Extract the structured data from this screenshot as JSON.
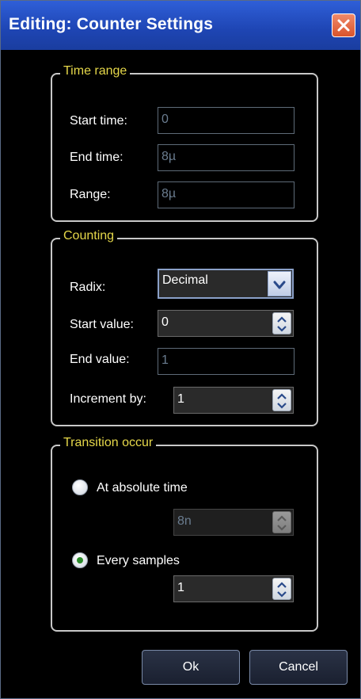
{
  "window": {
    "title": "Editing: Counter Settings"
  },
  "time_range": {
    "legend": "Time range",
    "start_label": "Start time:",
    "start_value": "0",
    "end_label": "End time:",
    "end_value": "8µ",
    "range_label": "Range:",
    "range_value": "8µ"
  },
  "counting": {
    "legend": "Counting",
    "radix_label": "Radix:",
    "radix_value": "Decimal",
    "start_label": "Start value:",
    "start_value": "0",
    "end_label": "End value:",
    "end_value": "1",
    "increment_label": "Increment by:",
    "increment_value": "1"
  },
  "transition": {
    "legend": "Transition occur",
    "absolute_label": "At absolute time",
    "absolute_value": "8n",
    "absolute_selected": false,
    "every_label": "Every samples",
    "every_value": "1",
    "every_selected": true
  },
  "buttons": {
    "ok": "Ok",
    "cancel": "Cancel"
  },
  "colors": {
    "title_bar": "#1e45b3",
    "legend_text": "#e6d84a",
    "close": "#d9542c",
    "selected_radio": "#2a8a2a"
  }
}
